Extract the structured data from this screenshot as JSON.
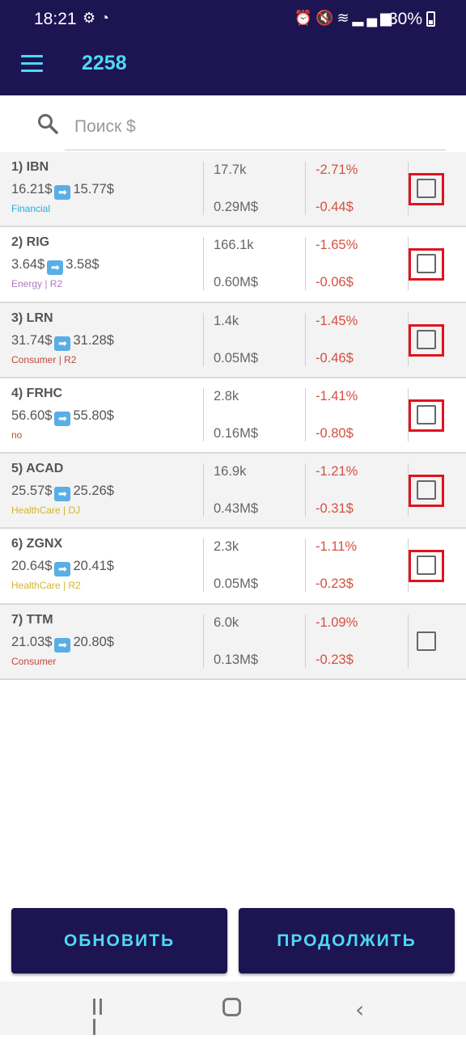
{
  "status_bar": {
    "time": "18:21",
    "left_icons": [
      "settings-gear-icon",
      "whatsapp-icon"
    ],
    "right_icons": [
      "alarm-icon",
      "mute-icon",
      "wifi-icon",
      "signal-icon"
    ],
    "battery": "30%"
  },
  "app_bar": {
    "title": "2258",
    "menu_icon": "hamburger-menu-icon"
  },
  "search": {
    "placeholder": "Поиск $",
    "value": ""
  },
  "colors": {
    "primary": "#1d1452",
    "accent": "#4dd9f4",
    "negative": "#d6503f",
    "highlight_outline": "#e0131f"
  },
  "rows": [
    {
      "ticker": "1) IBN",
      "price_from": "16.21$",
      "price_to": "15.77$",
      "sector": "Financial",
      "sector_color": "#29a9d6",
      "volume": "17.7k",
      "money": "0.29M$",
      "pct": "-2.71%",
      "usd": "-0.44$",
      "checked": false,
      "outlined": true
    },
    {
      "ticker": "2) RIG",
      "price_from": "3.64$",
      "price_to": "3.58$",
      "sector": "Energy | R2",
      "sector_color": "#b07ac4",
      "volume": "166.1k",
      "money": "0.60M$",
      "pct": "-1.65%",
      "usd": "-0.06$",
      "checked": false,
      "outlined": true
    },
    {
      "ticker": "3) LRN",
      "price_from": "31.74$",
      "price_to": "31.28$",
      "sector": "Consumer | R2",
      "sector_color": "#c2473a",
      "volume": "1.4k",
      "money": "0.05M$",
      "pct": "-1.45%",
      "usd": "-0.46$",
      "checked": false,
      "outlined": true
    },
    {
      "ticker": "4) FRHC",
      "price_from": "56.60$",
      "price_to": "55.80$",
      "sector": "no",
      "sector_color": "#c2473a",
      "volume": "2.8k",
      "money": "0.16M$",
      "pct": "-1.41%",
      "usd": "-0.80$",
      "checked": false,
      "outlined": true
    },
    {
      "ticker": "5) ACAD",
      "price_from": "25.57$",
      "price_to": "25.26$",
      "sector": "HealthCare | DJ",
      "sector_color": "#d4b52a",
      "volume": "16.9k",
      "money": "0.43M$",
      "pct": "-1.21%",
      "usd": "-0.31$",
      "checked": false,
      "outlined": true
    },
    {
      "ticker": "6) ZGNX",
      "price_from": "20.64$",
      "price_to": "20.41$",
      "sector": "HealthCare | R2",
      "sector_color": "#d4b52a",
      "volume": "2.3k",
      "money": "0.05M$",
      "pct": "-1.11%",
      "usd": "-0.23$",
      "checked": false,
      "outlined": true
    },
    {
      "ticker": "7) TTM",
      "price_from": "21.03$",
      "price_to": "20.80$",
      "sector": "Consumer",
      "sector_color": "#c2473a",
      "volume": "6.0k",
      "money": "0.13M$",
      "pct": "-1.09%",
      "usd": "-0.23$",
      "checked": false,
      "outlined": false
    }
  ],
  "buttons": {
    "refresh_label": "ОБНОВИТЬ",
    "continue_label": "ПРОДОЛЖИТЬ"
  },
  "nav_bar": {
    "icons": [
      "recent-apps-icon",
      "home-icon",
      "back-icon"
    ]
  }
}
